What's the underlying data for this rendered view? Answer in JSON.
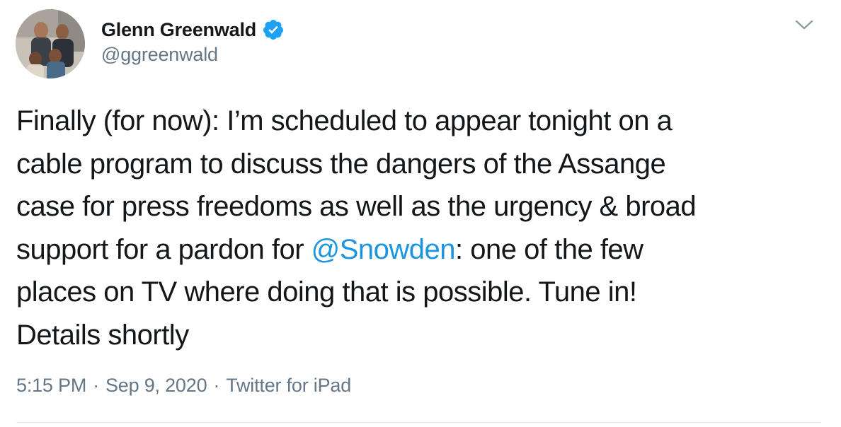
{
  "author": {
    "display_name": "Glenn Greenwald",
    "handle": "@ggreenwald",
    "verified_icon": "verified-badge-icon",
    "verified_color": "#1da1f2"
  },
  "tweet": {
    "lines": [
      {
        "before": "Finally (for now): I’m scheduled to appear tonight on a",
        "mention": "",
        "after": ""
      },
      {
        "before": "cable program to discuss the dangers of the Assange",
        "mention": "",
        "after": ""
      },
      {
        "before": "case for press freedoms as well as the urgency & broad",
        "mention": "",
        "after": ""
      },
      {
        "before": "support for a pardon for ",
        "mention": "@Snowden",
        "after": ": one of the few"
      },
      {
        "before": "places on TV where doing that is possible. Tune in!",
        "mention": "",
        "after": ""
      },
      {
        "before": "Details shortly",
        "mention": "",
        "after": ""
      }
    ],
    "mention_color": "#1b95e0"
  },
  "meta": {
    "time": "5:15 PM",
    "separator": "·",
    "date": "Sep 9, 2020",
    "source": "Twitter for iPad"
  },
  "menu": {
    "icon": "chevron-down-icon"
  }
}
